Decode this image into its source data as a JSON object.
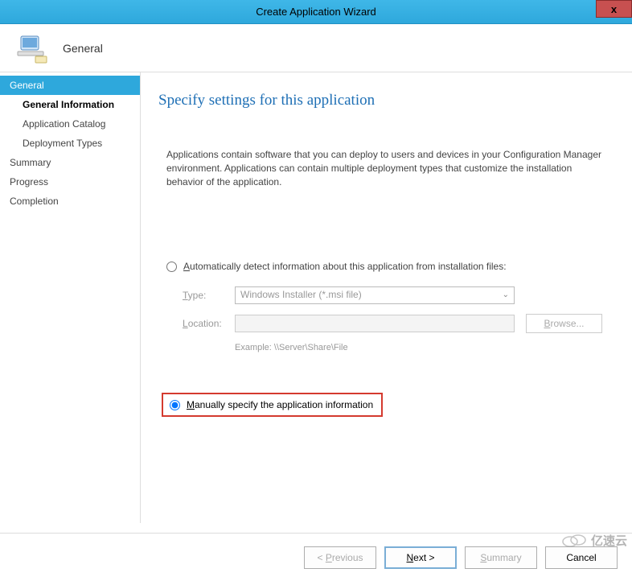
{
  "window": {
    "title": "Create Application Wizard",
    "close": "x"
  },
  "header": {
    "title": "General"
  },
  "sidebar": {
    "items": [
      {
        "label": "General",
        "active": true,
        "sub": false
      },
      {
        "label": "General Information",
        "active": false,
        "sub": true,
        "current": true
      },
      {
        "label": "Application Catalog",
        "active": false,
        "sub": true
      },
      {
        "label": "Deployment Types",
        "active": false,
        "sub": true
      },
      {
        "label": "Summary",
        "active": false,
        "sub": false
      },
      {
        "label": "Progress",
        "active": false,
        "sub": false
      },
      {
        "label": "Completion",
        "active": false,
        "sub": false
      }
    ]
  },
  "main": {
    "title": "Specify settings for this application",
    "description": "Applications contain software that you can deploy to users and devices in your Configuration Manager environment. Applications can contain multiple deployment types that customize the installation behavior of the application.",
    "radio_auto": "Automatically detect information about this application from installation files:",
    "type_label": "Type:",
    "type_value": "Windows Installer (*.msi file)",
    "location_label": "Location:",
    "location_value": "",
    "browse": "Browse...",
    "example": "Example: \\\\Server\\Share\\File",
    "radio_manual": "Manually specify the application information"
  },
  "footer": {
    "previous": "Previous",
    "next": "Next >",
    "summary": "Summary",
    "cancel": "Cancel"
  },
  "watermark": "亿速云"
}
